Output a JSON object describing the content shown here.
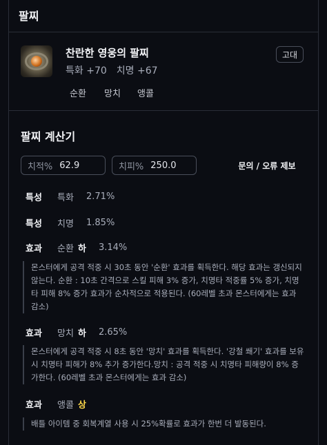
{
  "header": {
    "title": "팔찌"
  },
  "item": {
    "name": "찬란한 영웅의 팔찌",
    "stats": [
      "특화 +70",
      "치명 +67"
    ],
    "grade": "고대",
    "tags": [
      "순환",
      "망치",
      "앵콜"
    ]
  },
  "calculator": {
    "title": "팔찌 계산기",
    "crit_rate": {
      "label": "치적%",
      "value": "62.9"
    },
    "crit_damage": {
      "label": "치피%",
      "value": "250.0"
    },
    "report_label": "문의 / 오류 제보"
  },
  "effects": [
    {
      "category": "특성",
      "name": "특화",
      "level": "",
      "value": "2.71%",
      "description": ""
    },
    {
      "category": "특성",
      "name": "치명",
      "level": "",
      "value": "1.85%",
      "description": ""
    },
    {
      "category": "효과",
      "name": "순환",
      "level": "하",
      "value": "3.14%",
      "description": "몬스터에게 공격 적중 시 30초 동안 '순환' 효과를 획득한다. 해당 효과는 갱신되지 않는다. 순환 : 10초 간격으로 스킬 피해 3% 증가, 치명타 적중률 5% 증가, 치명타 피해 8% 증가 효과가 순차적으로 적용된다. (60레벨 초과 몬스터에게는 효과 감소)"
    },
    {
      "category": "효과",
      "name": "망치",
      "level": "하",
      "value": "2.65%",
      "description": "몬스터에게 공격 적중 시 8초 동안 '망치' 효과를 획득한다. '강철 쐐기' 효과를 보유 시 치명타 피해가 8% 추가 증가한다.망치 : 공격 적중 시 치명타 피해량이 8% 증가한다. (60레벨 초과 몬스터에게는 효과 감소)"
    },
    {
      "category": "효과",
      "name": "앵콜",
      "level": "상",
      "value": "",
      "description": "배틀 아이템 중 회복계열 사용 시 25%확률로 효과가 한번 더 발동된다."
    }
  ],
  "colors": {
    "background": "#0b0d13",
    "level_high": "#ffd94a",
    "muted_text": "#a9aebb"
  }
}
